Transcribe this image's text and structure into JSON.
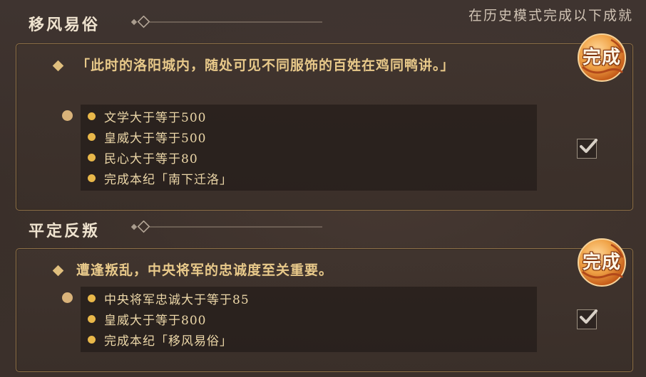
{
  "hint": "在历史模式完成以下成就",
  "sections": [
    {
      "title": "移风易俗",
      "description": "「此时的洛阳城内，随处可见不同服饰的百姓在鸡同鸭讲。」",
      "conditions": [
        "文学大于等于500",
        "皇威大于等于500",
        "民心大于等于80",
        "完成本纪「南下迁洛」"
      ],
      "status": "完成",
      "checked": true
    },
    {
      "title": "平定反叛",
      "description": "遭逢叛乱，中央将军的忠诚度至关重要。",
      "conditions": [
        "中央将军忠诚大于等于85",
        "皇威大于等于800",
        "完成本纪「移风易俗」"
      ],
      "status": "完成",
      "checked": true
    }
  ],
  "colors": {
    "accent_gold": "#e0bf7e",
    "condition_text": "#ecd7a8",
    "seal_orange": "#e07a2a",
    "panel_border": "#8f7147"
  }
}
